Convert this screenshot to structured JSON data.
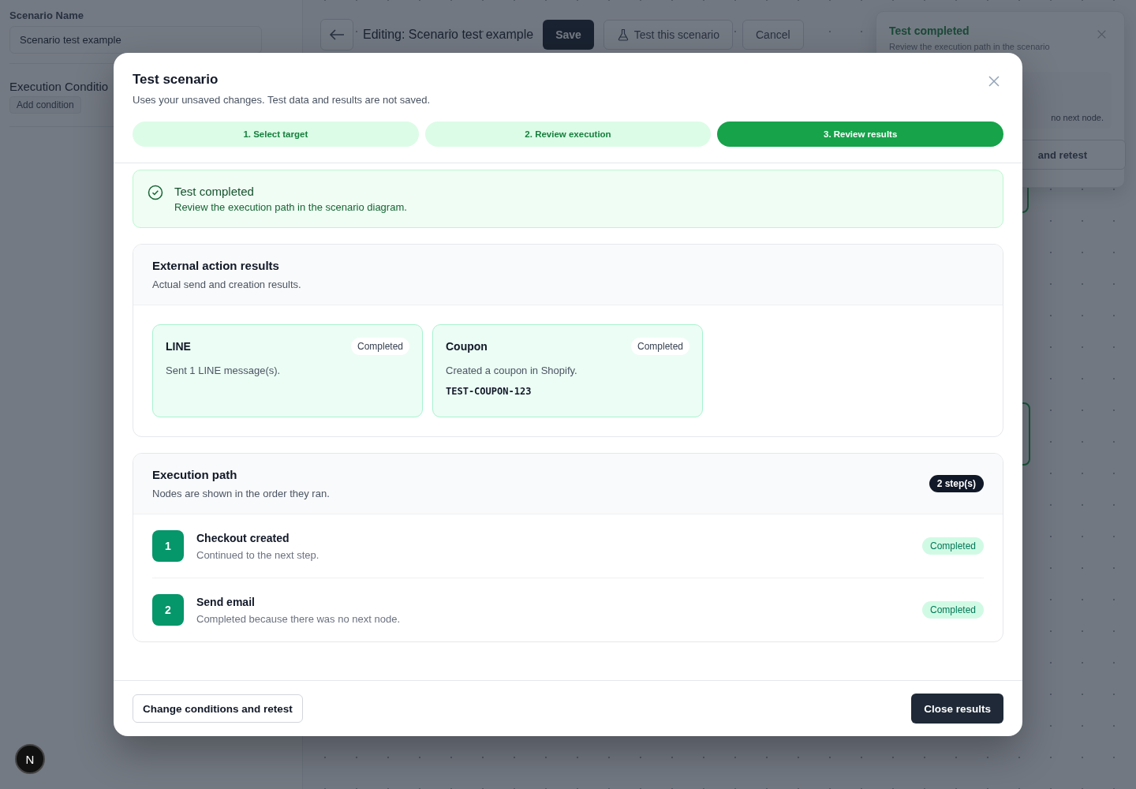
{
  "sidebar": {
    "name_label": "Scenario Name",
    "name_value": "Scenario test example",
    "conditions_title": "Execution Conditio",
    "add_condition": "Add condition"
  },
  "toolbar": {
    "title": "Editing: Scenario test example",
    "buttons": [
      {
        "label": "Save",
        "kind": "primary"
      },
      {
        "label": "Test this scenario",
        "kind": "test"
      },
      {
        "label": "Cancel",
        "kind": "secondary"
      }
    ]
  },
  "toast": {
    "title": "Test completed",
    "message": "Review the execution path in the scenario",
    "detail": "no next node.",
    "button": "and retest"
  },
  "dialog": {
    "title": "Test scenario",
    "subtitle": "Uses your unsaved changes. Test data and results are not saved.",
    "steps": [
      {
        "label": "1. Select target",
        "selected": false
      },
      {
        "label": "2. Review execution",
        "selected": false
      },
      {
        "label": "3. Review results",
        "selected": true
      }
    ],
    "banner": {
      "title": "Test completed",
      "message": "Review the execution path in the scenario diagram."
    },
    "external": {
      "title": "External action results",
      "subtitle": "Actual send and creation results.",
      "actions": [
        {
          "name": "LINE",
          "status": "Completed",
          "message": "Sent 1 LINE message(s)."
        },
        {
          "name": "Coupon",
          "status": "Completed",
          "message": "Created a coupon in Shopify.",
          "code": "TEST-COUPON-123"
        }
      ]
    },
    "path": {
      "title": "Execution path",
      "subtitle": "Nodes are shown in the order they ran.",
      "count": "2 step(s)",
      "steps": [
        {
          "number": "1",
          "name": "Checkout created",
          "detail": "Continued to the next step.",
          "status": "Completed"
        },
        {
          "number": "2",
          "name": "Send email",
          "detail": "Completed because there was no next node.",
          "status": "Completed"
        }
      ]
    },
    "footer": {
      "retest": "Change conditions and retest",
      "close": "Close results"
    }
  },
  "dev_badge": "N"
}
